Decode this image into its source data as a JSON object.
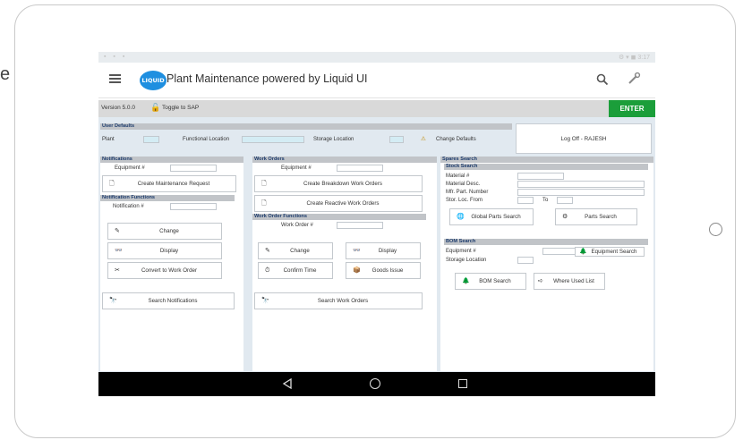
{
  "page": {
    "side_fragment": "e"
  },
  "status_bar": {
    "left_icons": "▪ ▪ ▪",
    "right_icons": "⚙ ▾ ◼ 3:17"
  },
  "app": {
    "title": "Plant Maintenance powered by Liquid UI",
    "logo_text": "LIQUID"
  },
  "toolbar": {
    "version": "Version 5.0.0",
    "toggle_label": "Toggle to SAP",
    "enter_label": "ENTER"
  },
  "user_defaults": {
    "header": "User Defaults",
    "plant_label": "Plant",
    "functional_location_label": "Functional Location",
    "storage_location_label": "Storage Location",
    "change_defaults_label": "Change Defaults",
    "logoff_label": "Log Off - RAJESH"
  },
  "notifications": {
    "header": "Notifications",
    "equipment_label": "Equipment #",
    "create_request_label": "Create Maintenance Request",
    "functions_header": "Notification Functions",
    "notification_label": "Notification #",
    "change_label": "Change",
    "display_label": "Display",
    "convert_label": "Convert to Work Order",
    "search_label": "Search Notifications"
  },
  "work_orders": {
    "header": "Work Orders",
    "equipment_label": "Equipment #",
    "create_breakdown_label": "Create Breakdown Work Orders",
    "create_reactive_label": "Create Reactive Work Orders",
    "functions_header": "Work Order Functions",
    "work_order_label": "Work Order #",
    "change_label": "Change",
    "display_label": "Display",
    "confirm_time_label": "Confirm Time",
    "goods_issue_label": "Goods Issue",
    "search_label": "Search Work Orders"
  },
  "spares": {
    "header": "Spares Search",
    "stock_header": "Stock Search",
    "material_label": "Material #",
    "material_desc_label": "Material Desc.",
    "mfr_part_label": "Mfr. Part. Number",
    "stor_loc_from_label": "Stor. Loc. From",
    "to_label": "To",
    "global_search_label": "Global Parts Search",
    "parts_search_label": "Parts Search",
    "bom_header": "BOM Search",
    "equipment_label": "Equipment #",
    "storage_location_label": "Storage Location",
    "equipment_search_label": "Equipment Search",
    "bom_search_label": "BOM Search",
    "where_used_label": "Where Used List"
  },
  "icons": {
    "document": "🗋",
    "pencil": "✎",
    "glasses": "👓",
    "convert": "✂",
    "binoculars": "🔭",
    "clock": "⏱",
    "goods": "📦",
    "globe": "🌐",
    "parts": "⚙",
    "tree": "🌲",
    "where": "➪",
    "warning": "⚠",
    "lock": "🔓"
  },
  "colors": {
    "enter_bg": "#1b9e3a",
    "section_header": "#1b3a6b",
    "content_bg": "#e1e9f0"
  }
}
